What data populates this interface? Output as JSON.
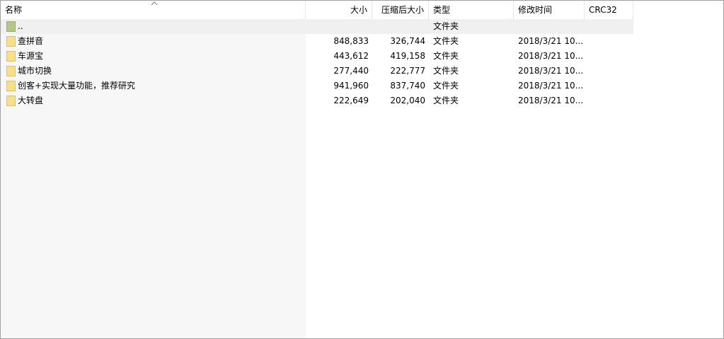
{
  "columns": {
    "name": "名称",
    "size": "大小",
    "packed": "压缩后大小",
    "type": "类型",
    "modified": "修改时间",
    "crc": "CRC32"
  },
  "parent_row": {
    "name": "..",
    "type": "文件夹"
  },
  "rows": [
    {
      "name": "查拼音",
      "size": "848,833",
      "packed": "326,744",
      "type": "文件夹",
      "modified": "2018/3/21 10...",
      "icon": "folder-icon"
    },
    {
      "name": "车源宝",
      "size": "443,612",
      "packed": "419,158",
      "type": "文件夹",
      "modified": "2018/3/21 10...",
      "icon": "folder-icon"
    },
    {
      "name": "城市切换",
      "size": "277,440",
      "packed": "222,777",
      "type": "文件夹",
      "modified": "2018/3/21 10...",
      "icon": "folder-icon"
    },
    {
      "name": "创客+实现大量功能，推荐研究",
      "size": "941,960",
      "packed": "837,740",
      "type": "文件夹",
      "modified": "2018/3/21 10...",
      "icon": "folder-icon"
    },
    {
      "name": "大转盘",
      "size": "222,649",
      "packed": "202,040",
      "type": "文件夹",
      "modified": "2018/3/21 10...",
      "icon": "folder-icon"
    }
  ],
  "colors": {
    "folder": "#f8df8a",
    "parent_folder": "#b5c58c",
    "sorted_column_bg": "#f7f7f7"
  }
}
